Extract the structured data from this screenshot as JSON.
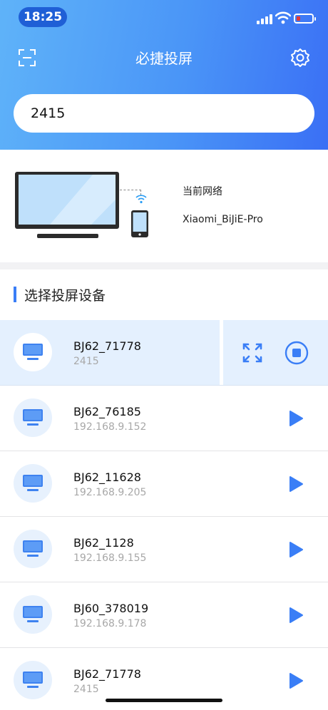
{
  "status": {
    "time": "18:25"
  },
  "header": {
    "title": "必捷投屏"
  },
  "search": {
    "value": "2415"
  },
  "network": {
    "label": "当前网络",
    "name": "Xiaomi_BiJiE-Pro"
  },
  "section": {
    "title": "选择投屏设备"
  },
  "devices": [
    {
      "name": "BJ62_71778",
      "sub": "2415",
      "active": true
    },
    {
      "name": "BJ62_76185",
      "sub": "192.168.9.152"
    },
    {
      "name": "BJ62_11628",
      "sub": "192.168.9.205"
    },
    {
      "name": "BJ62_1128",
      "sub": "192.168.9.155"
    },
    {
      "name": "BJ60_378019",
      "sub": "192.168.9.178"
    },
    {
      "name": "BJ62_71778",
      "sub": "2415"
    }
  ],
  "colors": {
    "accent": "#3a7ef6",
    "header_start": "#5fb3f9",
    "header_end": "#3a6ff5",
    "active_row": "#e4f0fe"
  },
  "icons": {
    "scan": "scan-icon",
    "settings": "gear-icon",
    "device": "monitor-icon",
    "play": "play-icon",
    "fullscreen": "fullscreen-icon",
    "stop": "stop-icon"
  }
}
